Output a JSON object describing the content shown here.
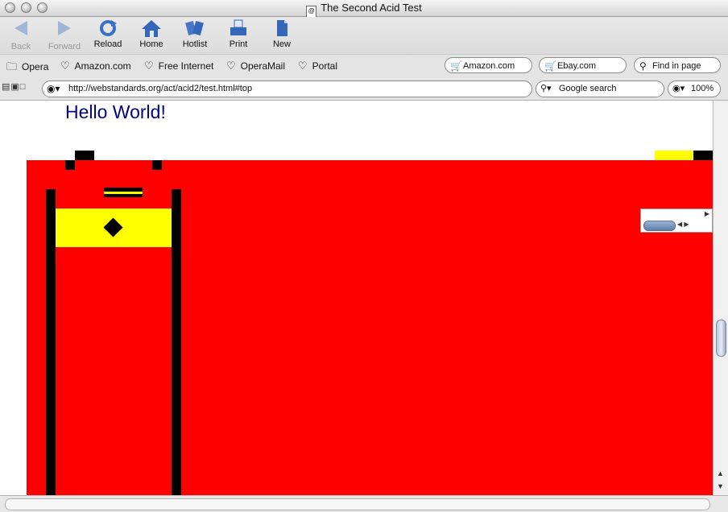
{
  "window": {
    "title": "The Second Acid Test"
  },
  "toolbar": {
    "back": "Back",
    "forward": "Forward",
    "reload": "Reload",
    "home": "Home",
    "hotlist": "Hotlist",
    "print": "Print",
    "new": "New"
  },
  "bookmarks": {
    "opera": "Opera",
    "amazon": "Amazon.com",
    "free_internet": "Free Internet",
    "operamail": "OperaMail",
    "portal": "Portal"
  },
  "search_pills": {
    "amazon": "Amazon.com",
    "ebay": "Ebay.com",
    "find": "Find in page"
  },
  "address": {
    "url": "http://webstandards.org/act/acid2/test.html#top",
    "search_engine": "Google search",
    "zoom": "100%"
  },
  "page": {
    "heading": "Hello World!",
    "heading_color": "#000080",
    "face_color": "#ff0000",
    "accent_color": "#ffff00"
  }
}
